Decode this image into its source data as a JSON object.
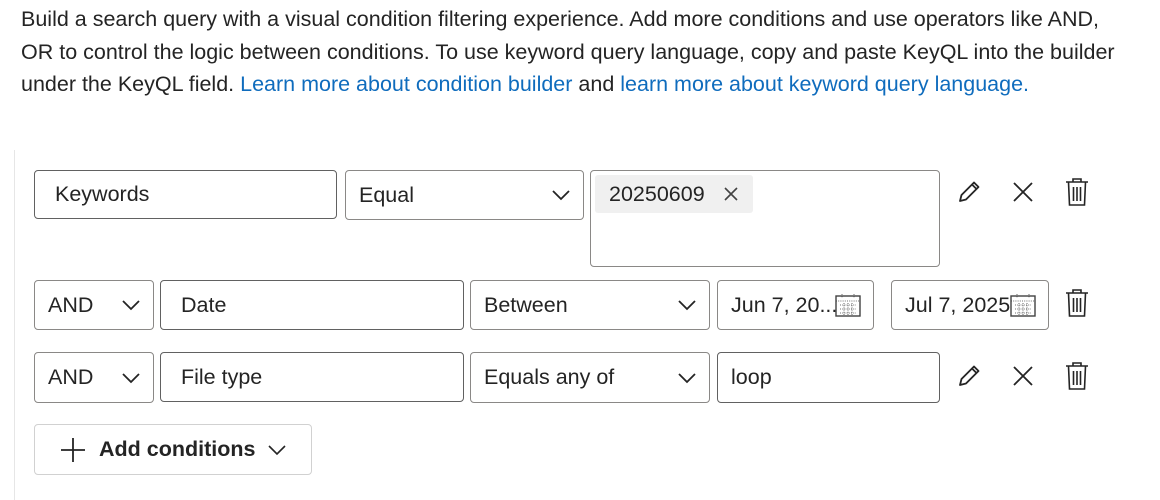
{
  "intro": {
    "text": "Build a search query with a visual condition filtering experience. Add more conditions and use operators like AND, OR to control the logic between conditions. To use keyword query language, copy and paste KeyQL into the builder under the KeyQL field.",
    "link1": "Learn more about condition builder",
    "joiner": "and",
    "link2": "learn more about keyword query language."
  },
  "conditions": [
    {
      "field": "Keywords",
      "operator": "Equal",
      "tag": "20250609"
    },
    {
      "logic": "AND",
      "field": "Date",
      "operator": "Between",
      "start": "Jun 7, 20...",
      "end": "Jul 7, 2025"
    },
    {
      "logic": "AND",
      "field": "File type",
      "operator": "Equals any of",
      "value": "loop"
    }
  ],
  "add_button": {
    "label": "Add conditions"
  },
  "colors": {
    "link": "#0f6cbd",
    "border": "#616161",
    "tag_bg": "#f0f0f0"
  },
  "icons": [
    "pencil-icon",
    "close-icon",
    "trash-icon",
    "chevron-down-icon",
    "calendar-icon",
    "plus-icon"
  ]
}
